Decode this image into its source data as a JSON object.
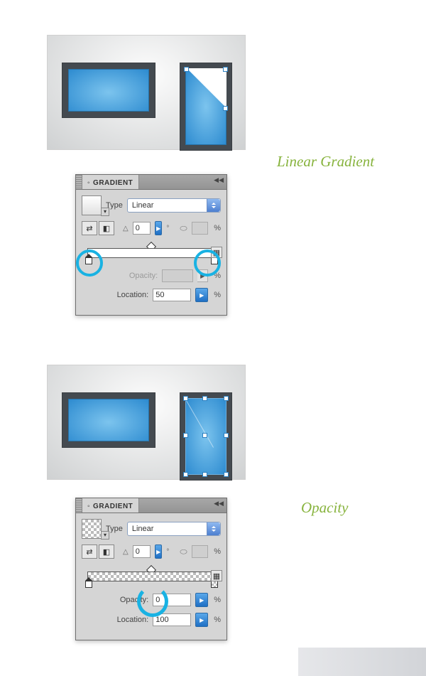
{
  "labels": {
    "linear_gradient": "Linear Gradient",
    "opacity": "Opacity"
  },
  "panel": {
    "title": "GRADIENT",
    "type_label": "Type",
    "type_value": "Linear",
    "angle_value": "0",
    "aspect_value": "",
    "opacity_label": "Opacity:",
    "location_label": "Location:"
  },
  "panel1": {
    "opacity_value": "",
    "location_value": "50"
  },
  "panel2": {
    "opacity_value": "0",
    "location_value": "100"
  },
  "chart_data": {
    "type": "table",
    "title": "Gradient panel states",
    "panels": [
      {
        "name": "Linear Gradient",
        "type": "Linear",
        "angle_deg": 0,
        "stops": [
          {
            "location_pct": 0,
            "color": "#ffffff"
          },
          {
            "location_pct": 100,
            "color": "#ffffff"
          }
        ],
        "midpoint_pct": 50,
        "selected_stop": {
          "location_pct": 50,
          "opacity_pct": null
        },
        "highlight": "both color stops circled"
      },
      {
        "name": "Opacity",
        "type": "Linear",
        "angle_deg": 0,
        "stops": [
          {
            "location_pct": 0,
            "opacity_pct": 100
          },
          {
            "location_pct": 100,
            "opacity_pct": 0
          }
        ],
        "midpoint_pct": 50,
        "selected_stop": {
          "location_pct": 100,
          "opacity_pct": 0
        },
        "highlight": "opacity field circled"
      }
    ]
  }
}
